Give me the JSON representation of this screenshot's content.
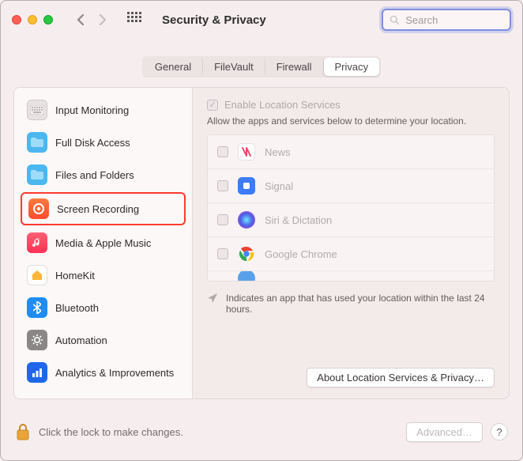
{
  "window": {
    "title": "Security & Privacy"
  },
  "search": {
    "placeholder": "Search"
  },
  "tabs": [
    {
      "label": "General",
      "active": false
    },
    {
      "label": "FileVault",
      "active": false
    },
    {
      "label": "Firewall",
      "active": false
    },
    {
      "label": "Privacy",
      "active": true
    }
  ],
  "sidebar": {
    "items": [
      {
        "label": "Input Monitoring",
        "icon": "keyboard-icon",
        "highlighted": false
      },
      {
        "label": "Full Disk Access",
        "icon": "folder-icon",
        "highlighted": false
      },
      {
        "label": "Files and Folders",
        "icon": "folder-icon",
        "highlighted": false
      },
      {
        "label": "Screen Recording",
        "icon": "record-icon",
        "highlighted": true
      },
      {
        "label": "Media & Apple Music",
        "icon": "music-icon",
        "highlighted": false
      },
      {
        "label": "HomeKit",
        "icon": "home-icon",
        "highlighted": false
      },
      {
        "label": "Bluetooth",
        "icon": "bluetooth-icon",
        "highlighted": false
      },
      {
        "label": "Automation",
        "icon": "gear-icon",
        "highlighted": false
      },
      {
        "label": "Analytics & Improvements",
        "icon": "chart-icon",
        "highlighted": false
      }
    ]
  },
  "detail": {
    "enable_label": "Enable Location Services",
    "enable_checked": true,
    "disabled": true,
    "description": "Allow the apps and services below to determine your location.",
    "apps": [
      {
        "name": "News",
        "icon": "news-icon",
        "checked": false
      },
      {
        "name": "Signal",
        "icon": "signal-icon",
        "checked": false
      },
      {
        "name": "Siri & Dictation",
        "icon": "siri-icon",
        "checked": false
      },
      {
        "name": "Google Chrome",
        "icon": "chrome-icon",
        "checked": false
      }
    ],
    "note": "Indicates an app that has used your location within the last 24 hours.",
    "about_button": "About Location Services & Privacy…"
  },
  "bottom": {
    "lock_text": "Click the lock to make changes.",
    "advanced_label": "Advanced…"
  },
  "colors": {
    "highlight_border": "#ff3b30",
    "focus_ring": "#7e8fe0"
  }
}
